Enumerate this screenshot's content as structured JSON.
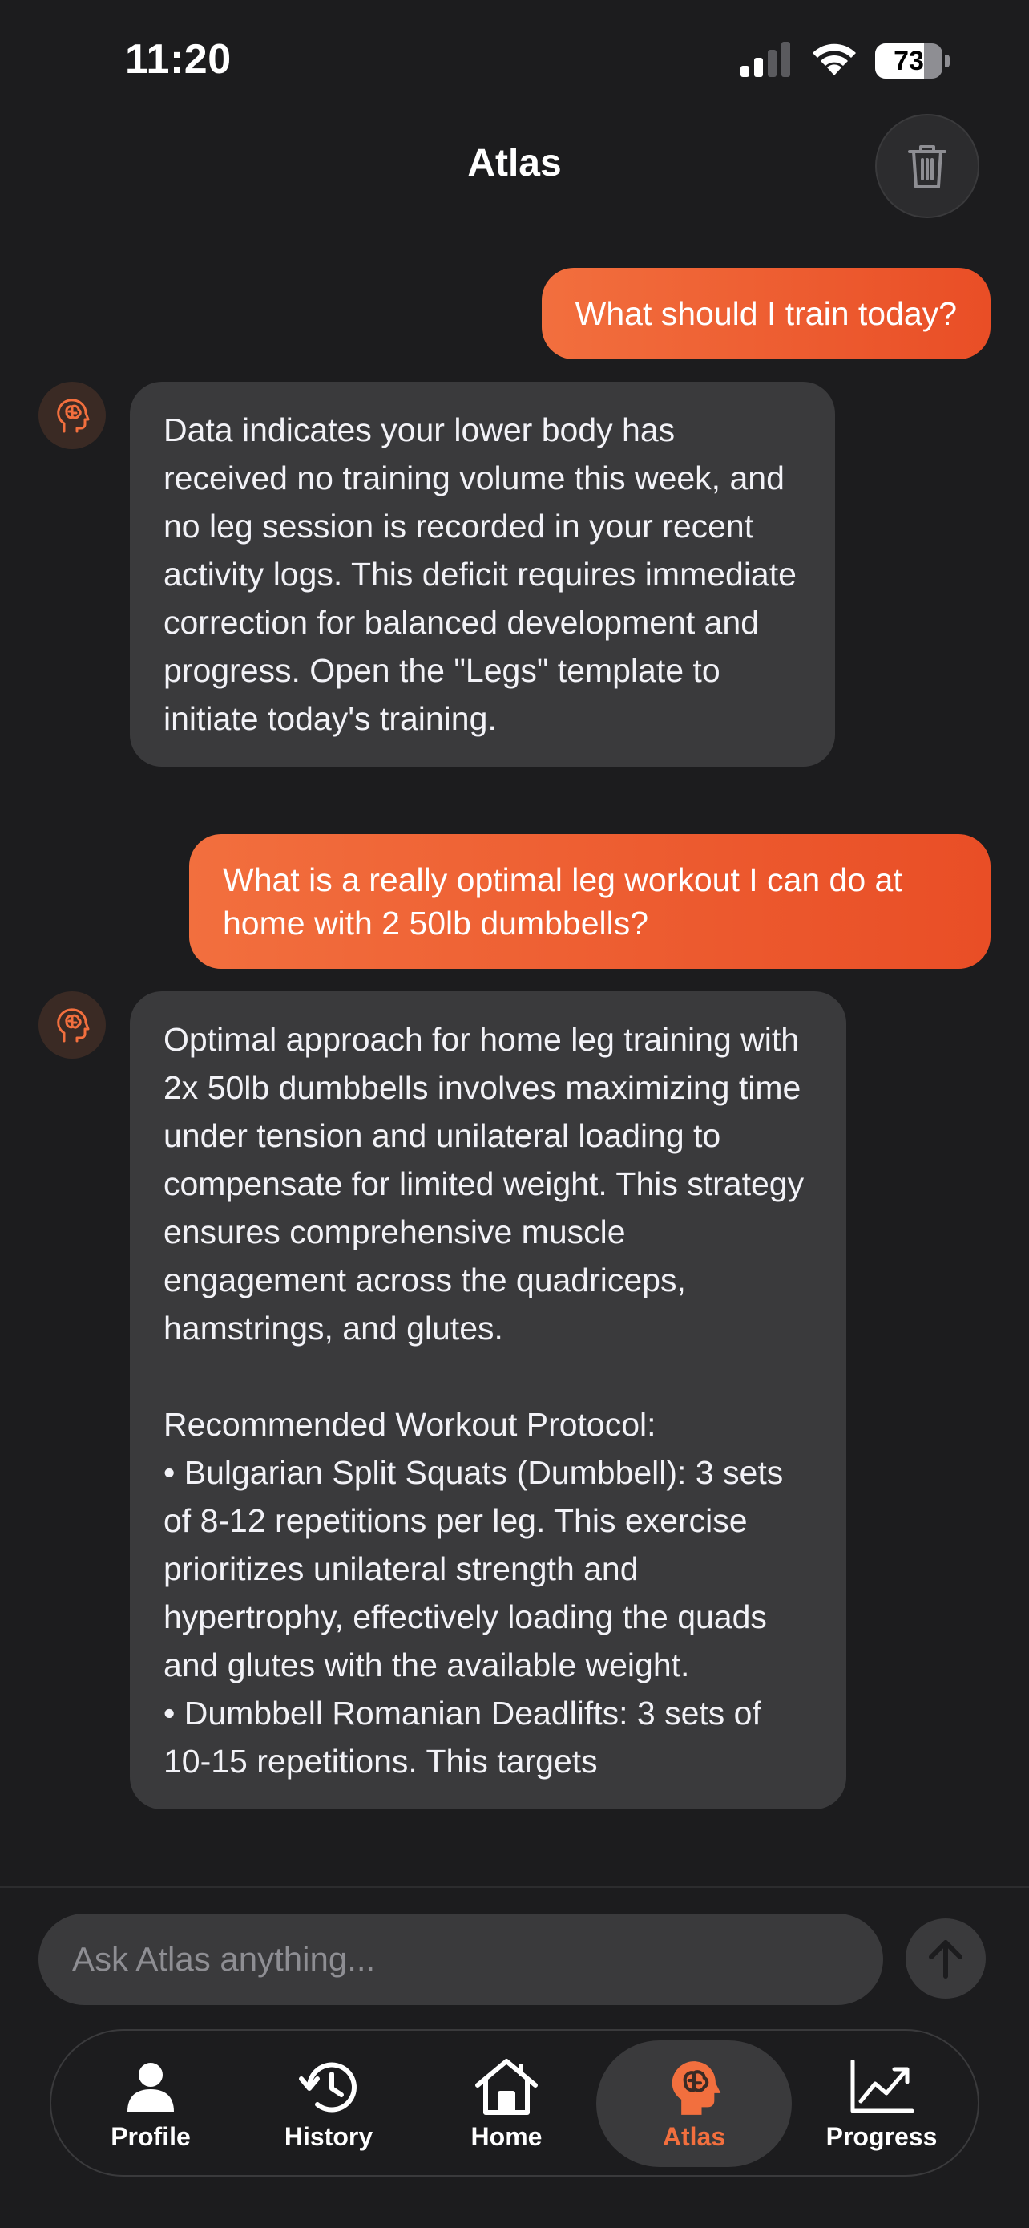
{
  "status_bar": {
    "time": "11:20",
    "battery_level": "73",
    "battery_fraction": 0.73
  },
  "header": {
    "title": "Atlas",
    "trash_icon": "trash-icon"
  },
  "colors": {
    "accent": "#f26f3e",
    "accent_dark": "#e94e26",
    "background": "#1c1c1e",
    "bubble": "#3a3a3c"
  },
  "messages": [
    {
      "role": "user",
      "text": "What should I train today?"
    },
    {
      "role": "assistant",
      "text": "Data indicates your lower body has received no training volume this week, and no leg session is recorded in your recent activity logs. This deficit requires immediate correction for balanced development and progress. Open the \"Legs\" template to initiate today's training."
    },
    {
      "role": "user",
      "text": "What is a really optimal leg workout I can do at home with 2 50lb dumbbells?"
    },
    {
      "role": "assistant",
      "text": "Optimal approach for home leg training with 2x 50lb dumbbells involves maximizing time under tension and unilateral loading to compensate for limited weight. This strategy ensures comprehensive muscle engagement across the quadriceps, hamstrings, and glutes.\n\nRecommended Workout Protocol:\n•   Bulgarian Split Squats (Dumbbell): 3 sets of 8-12 repetitions per leg. This exercise prioritizes unilateral strength and hypertrophy, effectively loading the quads and glutes with the available weight.\n•   Dumbbell Romanian Deadlifts: 3 sets of 10-15 repetitions. This targets"
    }
  ],
  "composer": {
    "placeholder": "Ask Atlas anything...",
    "send_icon": "arrow-up-icon"
  },
  "tab_bar": {
    "tabs": [
      {
        "label": "Profile",
        "icon": "person-icon",
        "active": false
      },
      {
        "label": "History",
        "icon": "history-icon",
        "active": false
      },
      {
        "label": "Home",
        "icon": "home-icon",
        "active": false
      },
      {
        "label": "Atlas",
        "icon": "brain-head-icon",
        "active": true
      },
      {
        "label": "Progress",
        "icon": "chart-icon",
        "active": false
      }
    ]
  }
}
